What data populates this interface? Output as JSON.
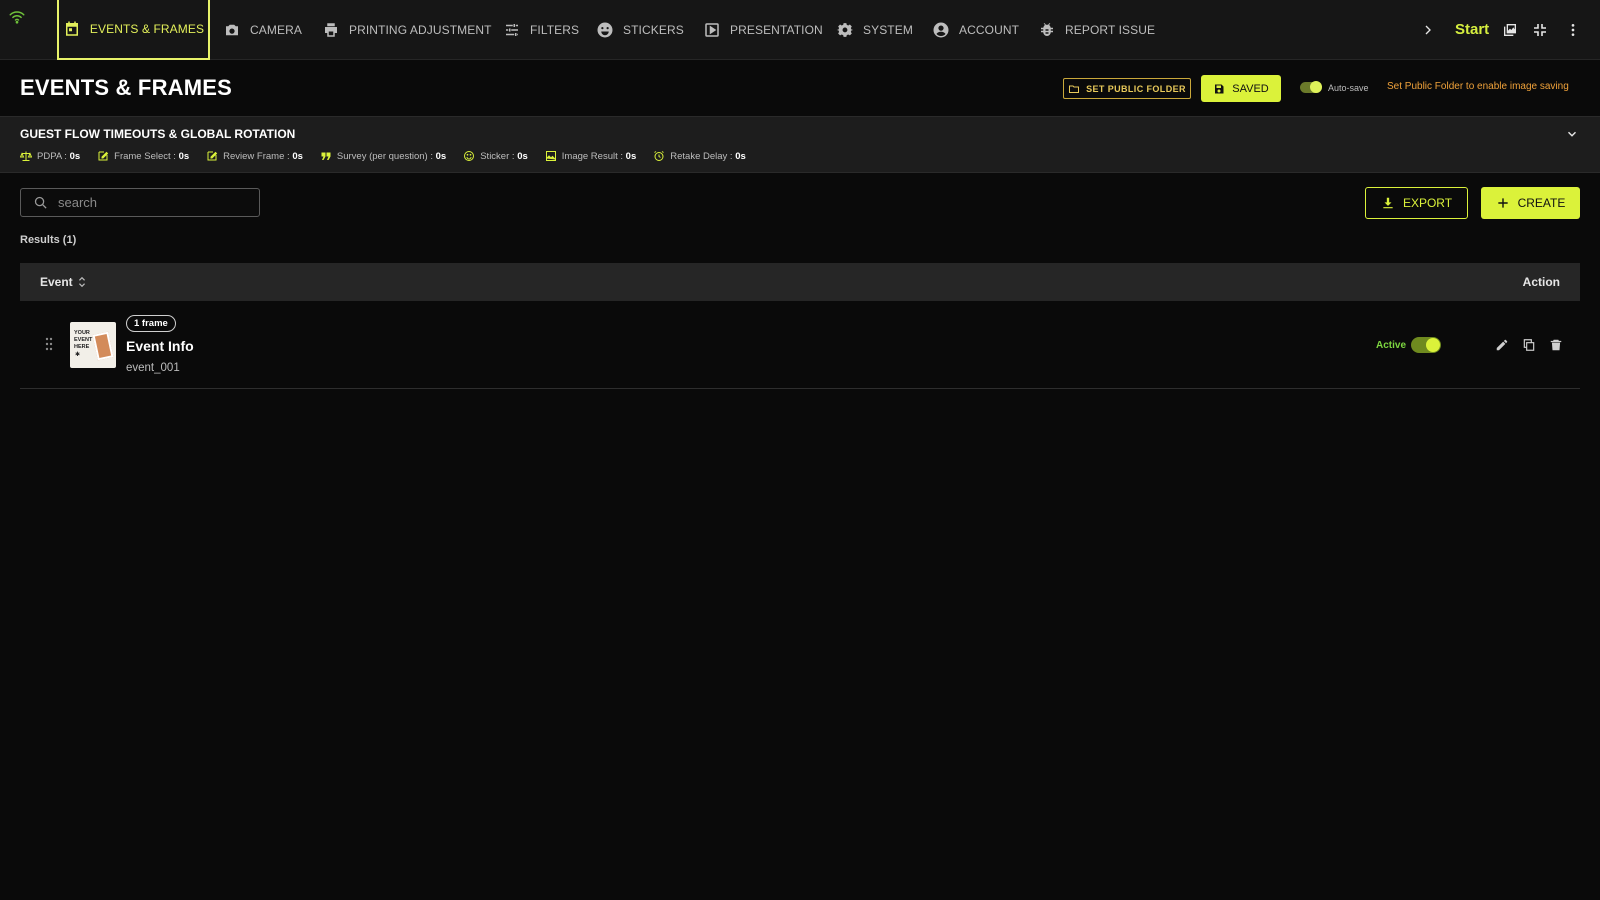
{
  "nav": {
    "tabs": [
      {
        "label": "EVENTS & FRAMES",
        "icon": "calendar-icon",
        "active": true
      },
      {
        "label": "CAMERA",
        "icon": "camera-icon"
      },
      {
        "label": "PRINTING ADJUSTMENT",
        "icon": "printer-icon"
      },
      {
        "label": "FILTERS",
        "icon": "sliders-icon"
      },
      {
        "label": "STICKERS",
        "icon": "smiley-icon"
      },
      {
        "label": "PRESENTATION",
        "icon": "play-icon"
      },
      {
        "label": "SYSTEM",
        "icon": "gear-icon"
      },
      {
        "label": "ACCOUNT",
        "icon": "account-icon"
      },
      {
        "label": "REPORT ISSUE",
        "icon": "bug-icon"
      }
    ],
    "start_label": "Start",
    "accent": "#dbf23a"
  },
  "header": {
    "title": "EVENTS & FRAMES",
    "set_public_folder_label": "SET PUBLIC FOLDER",
    "saved_label": "SAVED",
    "autosave_label": "Auto-save",
    "autosave_on": true,
    "warning": "Set Public Folder to enable image saving",
    "warning_color": "#f0a23a"
  },
  "flow": {
    "title": "GUEST FLOW TIMEOUTS & GLOBAL ROTATION",
    "items": [
      {
        "label": "PDPA",
        "value": "0s",
        "icon": "scale-icon"
      },
      {
        "label": "Frame Select",
        "value": "0s",
        "icon": "edit-frame-icon"
      },
      {
        "label": "Review Frame",
        "value": "0s",
        "icon": "edit-frame-icon"
      },
      {
        "label": "Survey (per question)",
        "value": "0s",
        "icon": "quote-icon"
      },
      {
        "label": "Sticker",
        "value": "0s",
        "icon": "smiley-icon"
      },
      {
        "label": "Image Result",
        "value": "0s",
        "icon": "image-icon"
      },
      {
        "label": "Retake Delay",
        "value": "0s",
        "icon": "alarm-icon"
      }
    ]
  },
  "toolbar": {
    "search_placeholder": "search",
    "export_label": "EXPORT",
    "create_label": "CREATE",
    "results_label": "Results (1)"
  },
  "table": {
    "columns": {
      "event": "Event",
      "action": "Action"
    },
    "rows": [
      {
        "badge": "1 frame",
        "name": "Event Info",
        "id": "event_001",
        "status": "Active",
        "active": true,
        "thumb_text": "YOUR EVENT HERE"
      }
    ]
  }
}
